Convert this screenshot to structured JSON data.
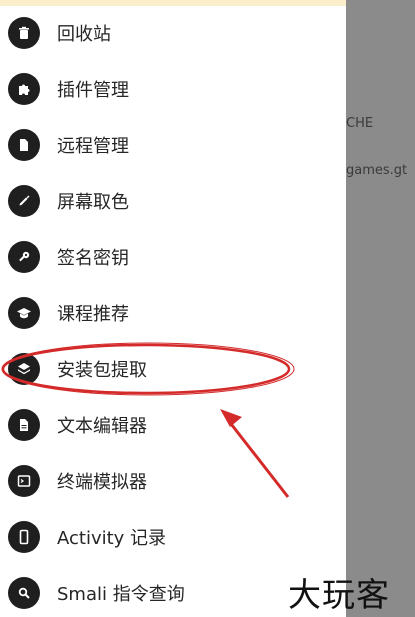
{
  "background": {
    "text_1": "CHE",
    "text_2": "games.gt"
  },
  "drawer": {
    "items": [
      {
        "label": "回收站",
        "icon": "trash-icon"
      },
      {
        "label": "插件管理",
        "icon": "puzzle-icon"
      },
      {
        "label": "远程管理",
        "icon": "file-icon"
      },
      {
        "label": "屏幕取色",
        "icon": "eyedropper-icon"
      },
      {
        "label": "签名密钥",
        "icon": "key-icon"
      },
      {
        "label": "课程推荐",
        "icon": "graduation-cap-icon"
      },
      {
        "label": "安装包提取",
        "icon": "layers-icon"
      },
      {
        "label": "文本编辑器",
        "icon": "document-icon"
      },
      {
        "label": "终端模拟器",
        "icon": "terminal-icon"
      },
      {
        "label": "Activity 记录",
        "icon": "phone-icon"
      },
      {
        "label": "Smali 指令查询",
        "icon": "search-icon"
      }
    ]
  },
  "watermark": "大玩客",
  "colors": {
    "icon_bg": "#1f1f1f",
    "scrim": "#8b8b8b",
    "annotation": "#d42a2a",
    "top_strip": "#fbeecb"
  }
}
